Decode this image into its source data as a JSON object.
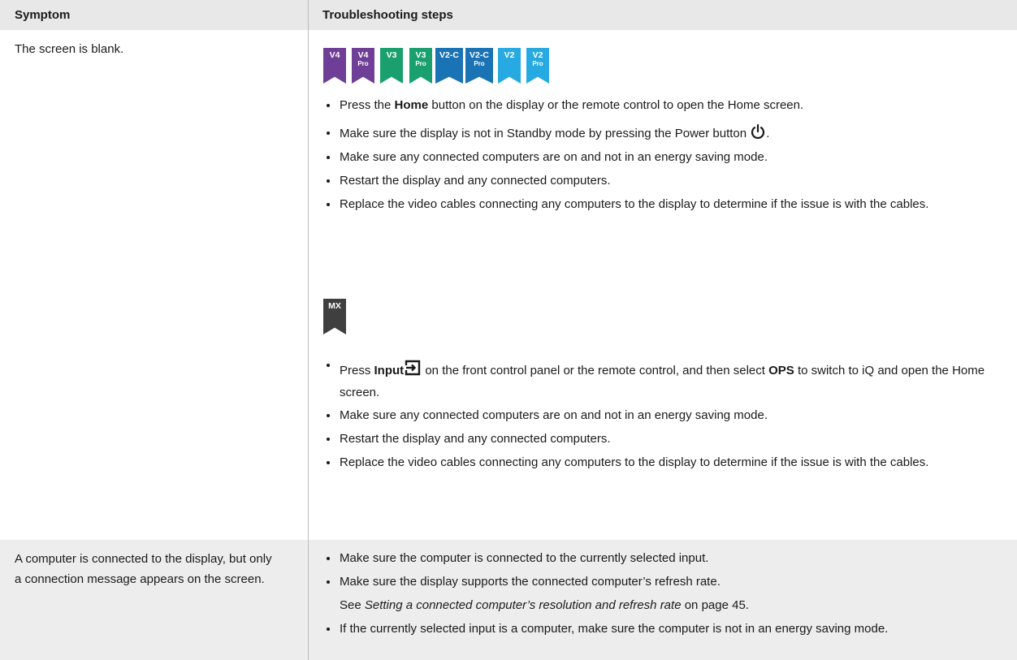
{
  "header": {
    "symptom_col": "Symptom",
    "steps_col": "Troubleshooting steps"
  },
  "colors": {
    "v4": "#6f3f98",
    "v3": "#1aa06e",
    "v2c": "#1a73b5",
    "v2": "#27a9e1",
    "mx": "#3f3f3f"
  },
  "row1": {
    "symptom": "The screen is blank.",
    "badges": [
      {
        "ver": "V4",
        "sub": ""
      },
      {
        "ver": "V4",
        "sub": "Pro"
      },
      {
        "ver": "V3",
        "sub": ""
      },
      {
        "ver": "V3",
        "sub": "Pro"
      },
      {
        "ver": "V2-C",
        "sub": ""
      },
      {
        "ver": "V2-C",
        "sub": "Pro"
      },
      {
        "ver": "V2",
        "sub": ""
      },
      {
        "ver": "V2",
        "sub": "Pro"
      }
    ],
    "group1": {
      "s1_a": "Press the ",
      "s1_b": "Home",
      "s1_c": " button on the display or the remote control to open the Home screen.",
      "s2": "Make sure the display is not in Standby mode by pressing the Power button",
      "s2_end": ".",
      "s3": "Make sure any connected computers are on and not in an energy saving mode.",
      "s4": "Restart the display and any connected computers.",
      "s5": "Replace the video cables connecting any computers to the display to determine if the issue is with the cables."
    },
    "mx_badge": "MX",
    "group2": {
      "s1_a": "Press ",
      "s1_b": "Input",
      "s1_c": " on the front control panel or the remote control, and then select ",
      "s1_d": "OPS",
      "s1_e": " to switch to iQ and open the Home screen.",
      "s2": "Make sure any connected computers are on and not in an energy saving mode.",
      "s3": "Restart the display and any connected computers.",
      "s4": "Replace the video cables connecting any computers to the display to determine if the issue is with the cables."
    }
  },
  "row2": {
    "symptom": "A computer is connected to the display, but only a connection message appears on the screen.",
    "s1": "Make sure the computer is connected to the currently selected input.",
    "s2": "Make sure the display supports the connected computer’s refresh rate.",
    "see_a": "See ",
    "see_link": "Setting a connected computer’s resolution and refresh rate",
    "see_b": " on page 45.",
    "s3": "If the currently selected input is a computer, make sure the computer is not in an energy saving mode."
  }
}
